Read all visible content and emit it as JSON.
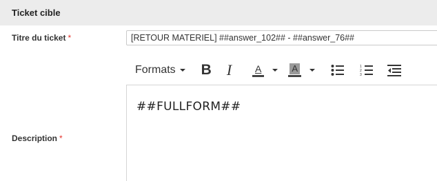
{
  "section": {
    "title": "Ticket cible"
  },
  "ticket_title": {
    "label": "Titre du ticket",
    "required_mark": "*",
    "value": "[RETOUR MATERIEL] ##answer_102## - ##answer_76##"
  },
  "description": {
    "label": "Description",
    "required_mark": "*",
    "content": "##FULLFORM##"
  },
  "toolbar": {
    "formats_label": "Formats",
    "bold_label": "B",
    "italic_label": "I",
    "font_color_label": "A",
    "bg_color_label": "A"
  },
  "colors": {
    "required": "#e4322b",
    "header_bg": "#ececec",
    "highlight": "#9a9a9a"
  },
  "icons": [
    "chevron-down-icon",
    "bold-icon",
    "italic-icon",
    "text-color-icon",
    "background-color-icon",
    "bullet-list-icon",
    "numbered-list-icon",
    "outdent-icon"
  ]
}
